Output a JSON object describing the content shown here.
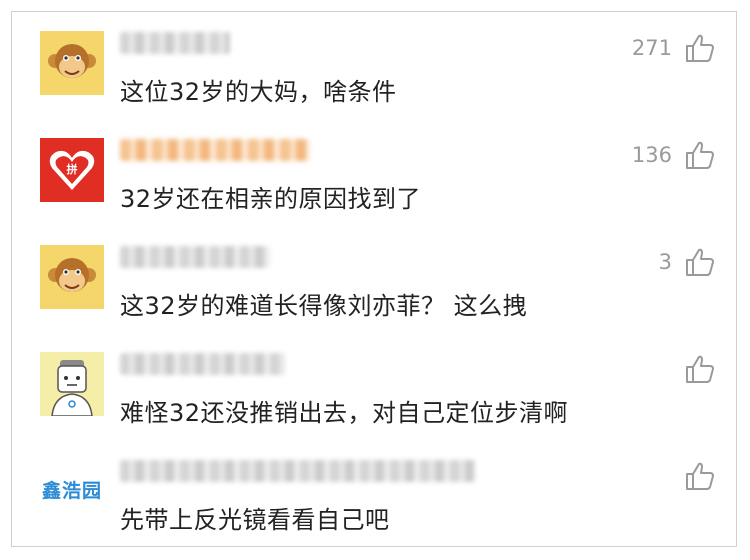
{
  "comments": [
    {
      "avatar": "monkey-avatar-icon",
      "text": "这位32岁的大妈，啥条件",
      "likes": "271"
    },
    {
      "avatar": "pinduoduo-logo-icon",
      "text": "32岁还在相亲的原因找到了",
      "likes": "136"
    },
    {
      "avatar": "monkey-avatar-icon",
      "text": "这32岁的难道长得像刘亦菲？ 这么拽",
      "likes": "3"
    },
    {
      "avatar": "cartoon-man-avatar-icon",
      "text": "难怪32还没推销出去，对自己定位步清啊",
      "likes": ""
    },
    {
      "avatar": "text-logo-avatar",
      "logo_text": "鑫浩园",
      "text": "先带上反光镜看看自己吧",
      "likes": ""
    }
  ],
  "colors": {
    "like_count": "#9a9a9a",
    "comment_text": "#222222",
    "monkey_bg": "#f5d66a",
    "pinduoduo_red": "#e02e24",
    "logo_blue": "#2a8bd6"
  }
}
